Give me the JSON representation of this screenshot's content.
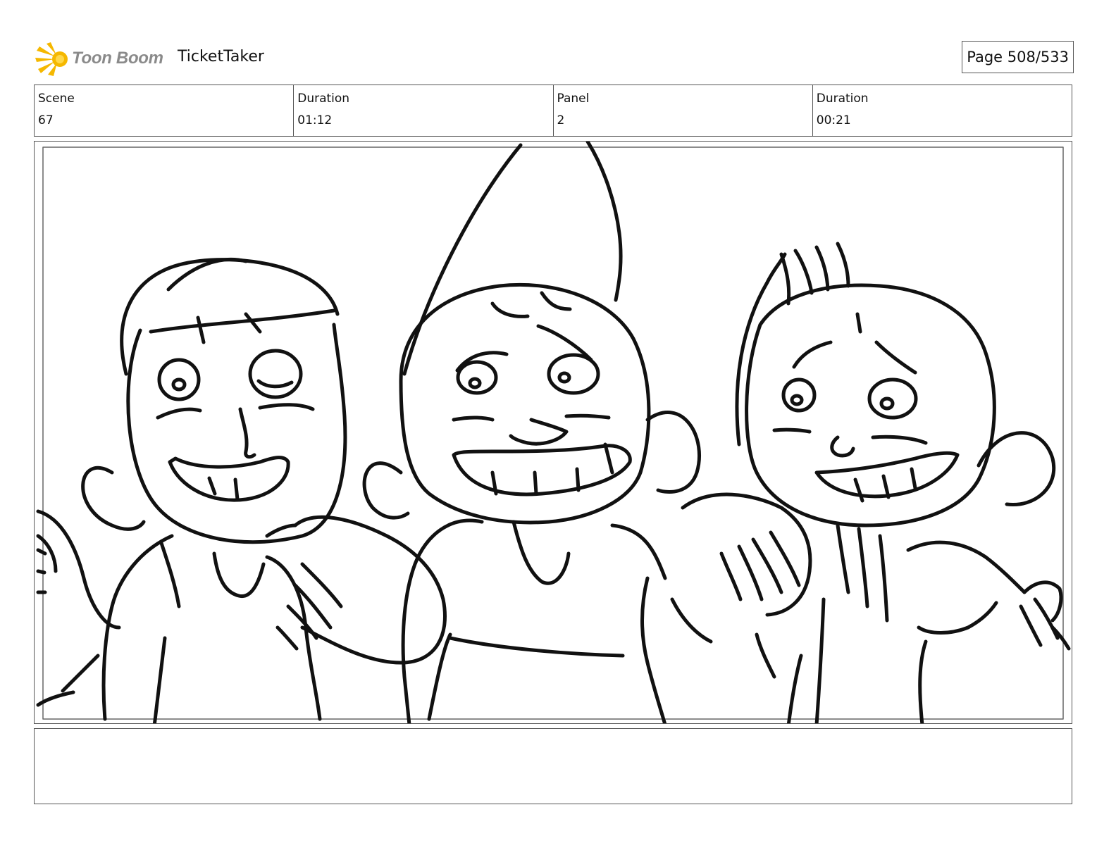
{
  "header": {
    "logo_text": "Toon Boom",
    "project_title": "TicketTaker",
    "page_label": "Page 508/533"
  },
  "info": [
    {
      "label": "Scene",
      "value": "67"
    },
    {
      "label": "Duration",
      "value": "01:12"
    },
    {
      "label": "Panel",
      "value": "2"
    },
    {
      "label": "Duration",
      "value": "00:21"
    }
  ],
  "panel": {
    "image_description_icon": "storyboard-sketch-three-boys"
  },
  "notes": {
    "text": ""
  },
  "colors": {
    "logo_yellow": "#f5b800",
    "logo_gray": "#8a8a8a",
    "border": "#555555",
    "ink": "#111111"
  }
}
